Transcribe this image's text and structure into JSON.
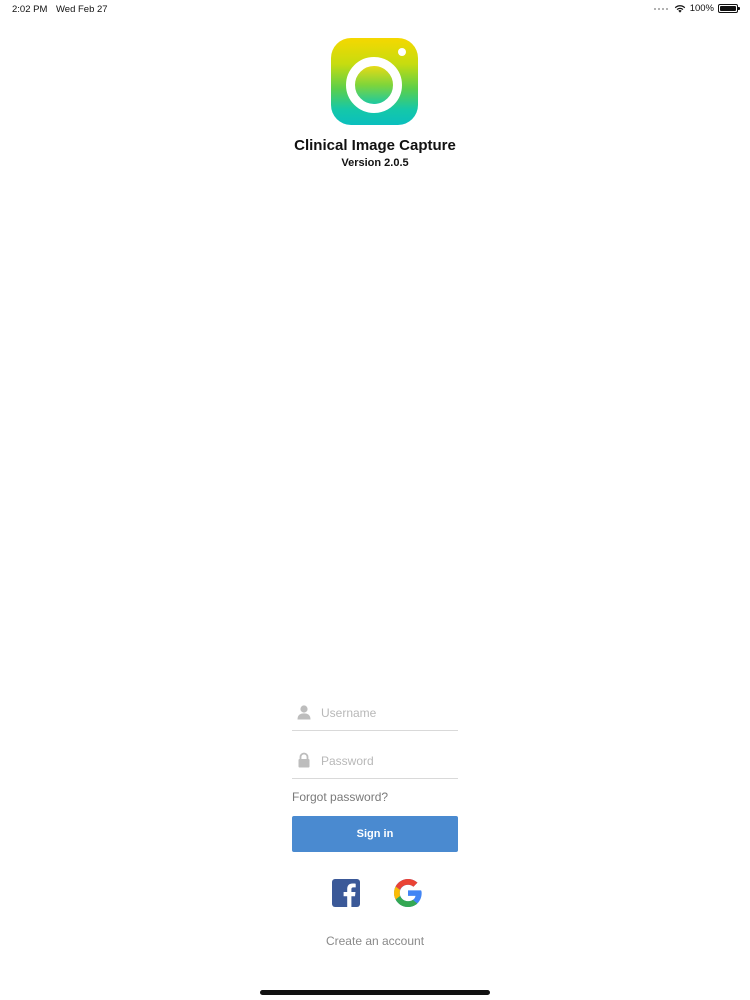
{
  "status_bar": {
    "time": "2:02 PM",
    "date": "Wed Feb 27",
    "battery_percent": "100%",
    "icons": [
      "signal-dots-icon",
      "wifi-icon",
      "battery-icon"
    ]
  },
  "header": {
    "icon": "camera-lens-app-icon",
    "title": "Clinical Image Capture",
    "version": "Version 2.0.5"
  },
  "login": {
    "username": {
      "placeholder": "Username",
      "value": "",
      "icon": "user-icon"
    },
    "password": {
      "placeholder": "Password",
      "value": "",
      "icon": "lock-icon"
    },
    "forgot_password": "Forgot password?",
    "sign_in": "Sign in",
    "social": [
      "facebook-icon",
      "google-icon"
    ],
    "create_account": "Create an account"
  },
  "colors": {
    "primary": "#4a8ad0",
    "facebook": "#3b5998",
    "text": "#111111",
    "muted_text": "#8a8a8a",
    "placeholder": "#b8b8b8"
  }
}
